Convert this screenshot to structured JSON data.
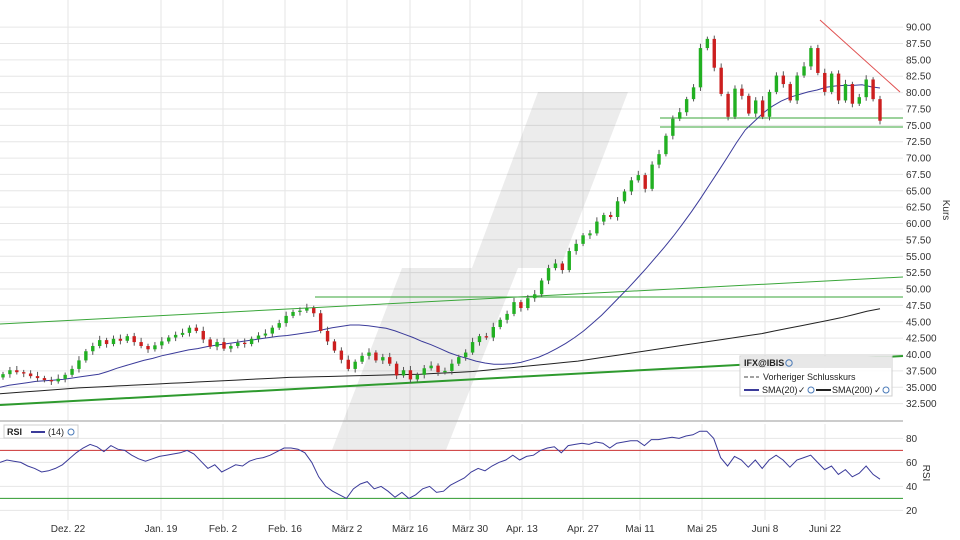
{
  "chart_data": [
    {
      "type": "candlestick",
      "legend": {
        "symbol": "IFX@IBIS",
        "items": [
          "Vorheriger Schlusskurs",
          "SMA(20)",
          "SMA(200)"
        ]
      },
      "ylabel": "Kurs",
      "ylim": [
        30.0,
        92.0
      ],
      "y_ticks": [
        "90.00",
        "87.50",
        "85.00",
        "82.50",
        "80.00",
        "77.50",
        "75.00",
        "72.50",
        "70.00",
        "67.50",
        "65.00",
        "62.50",
        "60.00",
        "57.50",
        "55.00",
        "52.50",
        "50.00",
        "47.50",
        "45.00",
        "42.500",
        "40.00",
        "37.500",
        "35.000",
        "32.500"
      ],
      "x_ticks": [
        "Dez. 22",
        "Jan. 19",
        "Feb. 2",
        "Feb. 16",
        "März 2",
        "März 16",
        "März 30",
        "Apr. 13",
        "Apr. 27",
        "Mai 11",
        "Mai 25",
        "Juni 8",
        "Juni 22"
      ],
      "close": [
        37.0,
        37.6,
        37.3,
        37.1,
        36.7,
        36.4,
        36.1,
        35.9,
        36.3,
        36.9,
        37.8,
        39.1,
        40.5,
        41.3,
        42.2,
        41.6,
        42.4,
        42.1,
        42.8,
        41.9,
        41.3,
        40.8,
        41.4,
        42.0,
        42.6,
        43.0,
        43.3,
        44.1,
        43.6,
        42.3,
        41.2,
        41.9,
        40.9,
        41.3,
        41.8,
        41.6,
        42.4,
        42.9,
        43.2,
        44.1,
        44.8,
        45.9,
        46.5,
        46.7,
        47.1,
        46.3,
        43.6,
        42.0,
        40.6,
        39.2,
        37.8,
        38.9,
        39.8,
        40.3,
        39.1,
        39.6,
        38.6,
        36.8,
        37.6,
        36.2,
        36.9,
        37.9,
        38.3,
        37.3,
        37.5,
        38.6,
        39.6,
        40.3,
        41.9,
        42.8,
        42.6,
        44.2,
        45.3,
        46.2,
        48.0,
        47.1,
        48.6,
        49.2,
        51.3,
        53.2,
        53.9,
        52.9,
        55.8,
        56.9,
        58.2,
        58.5,
        60.3,
        61.3,
        61.0,
        63.4,
        64.9,
        66.6,
        67.4,
        65.3,
        69.0,
        70.6,
        73.4,
        76.0,
        77.0,
        79.0,
        80.8,
        86.8,
        88.2,
        83.8,
        79.8,
        76.3,
        80.6,
        79.5,
        76.8,
        78.8,
        76.3,
        80.1,
        82.6,
        81.3,
        78.8,
        82.6,
        84.0,
        86.8,
        83.0,
        80.1,
        82.9,
        78.8,
        81.3,
        78.3,
        79.3,
        82.0,
        79.0,
        75.7
      ],
      "sma20": [
        35.0,
        35.3,
        35.5,
        35.7,
        35.9,
        36.0,
        36.1,
        36.2,
        36.4,
        36.6,
        36.8,
        37.0,
        37.4,
        37.9,
        38.3,
        38.7,
        39.1,
        39.4,
        39.8,
        40.1,
        40.4,
        40.7,
        40.9,
        41.2,
        41.4,
        41.6,
        41.8,
        42.0,
        42.2,
        42.4,
        42.6,
        42.8,
        42.9,
        43.1,
        43.3,
        43.5,
        43.8,
        44.1,
        44.3,
        44.5,
        44.5,
        44.4,
        44.2,
        44.0,
        43.6,
        43.1,
        42.6,
        42.0,
        41.5,
        40.9,
        40.3,
        39.8,
        39.4,
        39.0,
        38.7,
        38.5,
        38.5,
        38.6,
        38.8,
        39.2,
        39.6,
        40.2,
        40.9,
        41.7,
        42.6,
        43.6,
        44.8,
        46.0,
        47.4,
        48.8,
        50.2,
        51.7,
        53.2,
        54.8,
        56.4,
        58.1,
        59.9,
        61.8,
        63.8,
        65.9,
        68.0,
        70.1,
        72.3,
        74.3,
        75.6,
        76.9,
        77.9,
        78.7,
        79.3,
        79.7,
        80.1,
        80.4,
        80.8,
        81.0,
        81.1,
        81.1,
        81.2,
        80.9,
        80.7
      ],
      "sma200": [
        34.0,
        34.15,
        34.3,
        34.45,
        34.6,
        34.75,
        34.9,
        35.0,
        35.1,
        35.2,
        35.3,
        35.4,
        35.5,
        35.6,
        35.7,
        35.8,
        35.9,
        36.0,
        36.1,
        36.2,
        36.3,
        36.4,
        36.5,
        36.55,
        36.6,
        36.65,
        36.7,
        36.75,
        36.8,
        36.85,
        36.9,
        36.95,
        37.0,
        37.1,
        37.2,
        37.3,
        37.4,
        37.6,
        37.8,
        38.0,
        38.2,
        38.4,
        38.6,
        38.8,
        39.0,
        39.3,
        39.6,
        39.9,
        40.2,
        40.5,
        40.8,
        41.1,
        41.4,
        41.7,
        42.0,
        42.3,
        42.6,
        42.9,
        43.2,
        43.6,
        44.0,
        44.4,
        44.8,
        45.2,
        45.6,
        46.1,
        46.6,
        47.0
      ]
    },
    {
      "type": "line",
      "label": "RSI",
      "legend_item": "(14)",
      "ylabel": "RSI",
      "ylim": [
        12,
        92
      ],
      "y_ticks": [
        "80",
        "60",
        "40",
        "20"
      ],
      "reference_lines": [
        70,
        30
      ],
      "values": [
        60,
        62,
        61,
        60,
        57,
        55,
        52,
        53,
        55,
        58,
        63,
        68,
        72,
        75,
        73,
        69,
        74,
        71,
        70,
        66,
        63,
        61,
        63,
        65,
        66,
        67,
        68,
        70,
        67,
        61,
        55,
        58,
        52,
        55,
        58,
        57,
        61,
        63,
        64,
        66,
        69,
        72,
        72,
        71,
        68,
        60,
        48,
        40,
        36,
        33,
        30,
        38,
        42,
        44,
        38,
        40,
        36,
        31,
        35,
        30,
        33,
        38,
        40,
        35,
        36,
        41,
        44,
        47,
        52,
        55,
        53,
        57,
        60,
        62,
        66,
        62,
        65,
        66,
        70,
        72,
        73,
        68,
        74,
        75,
        76,
        75,
        77,
        76,
        72,
        76,
        77,
        78,
        78,
        74,
        79,
        79,
        80,
        81,
        80,
        82,
        83,
        86,
        86,
        80,
        64,
        57,
        65,
        62,
        56,
        62,
        55,
        62,
        66,
        62,
        56,
        62,
        64,
        66,
        60,
        54,
        57,
        50,
        54,
        48,
        51,
        57,
        50,
        46
      ]
    }
  ]
}
